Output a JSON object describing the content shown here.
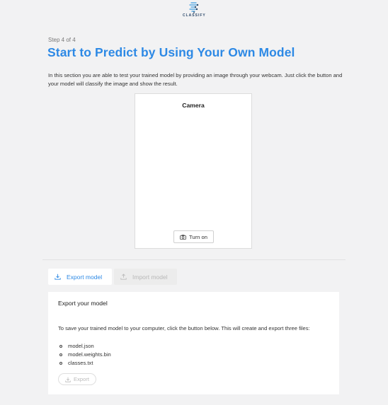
{
  "logo": {
    "icon": "brain-circuit-logo",
    "text": "CLASSIFY"
  },
  "step": "Step 4 of 4",
  "title": "Start to Predict by Using Your Own Model",
  "description": "In this section you are able to test your trained model by providing an image through your webcam. Just click the button and your model will classify the image and show the result.",
  "camera": {
    "title": "Camera",
    "button_label": "Turn on",
    "button_icon": "camera-icon"
  },
  "tabs": [
    {
      "label": "Export model",
      "icon": "download-icon",
      "active": true
    },
    {
      "label": "Import model",
      "icon": "upload-icon",
      "active": false
    }
  ],
  "export_panel": {
    "title": "Export your model",
    "text": "To save your trained model to your computer, click the button below. This will create and export three files:",
    "files": [
      "model.json",
      "model.weights.bin",
      "classes.txt"
    ],
    "button_label": "Export",
    "button_icon": "download-icon"
  },
  "colors": {
    "accent": "#2d89e5",
    "background": "#f2f2f3"
  }
}
